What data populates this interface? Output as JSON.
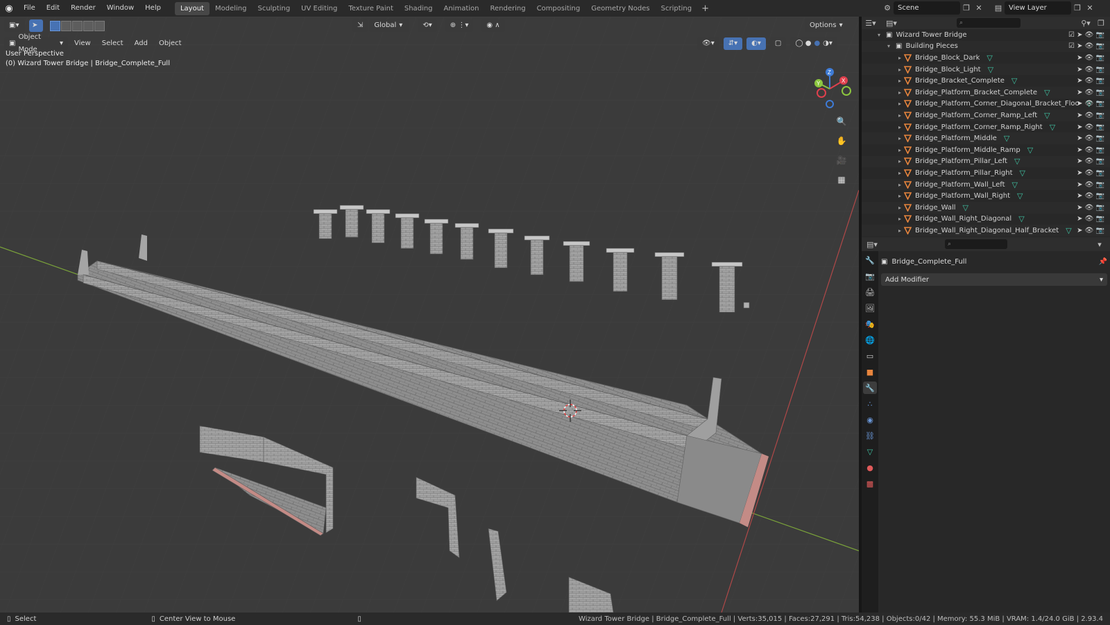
{
  "menu": {
    "file": "File",
    "edit": "Edit",
    "render": "Render",
    "window": "Window",
    "help": "Help"
  },
  "workspaces": [
    "Layout",
    "Modeling",
    "Sculpting",
    "UV Editing",
    "Texture Paint",
    "Shading",
    "Animation",
    "Rendering",
    "Compositing",
    "Geometry Nodes",
    "Scripting"
  ],
  "active_workspace": "Layout",
  "scene": {
    "name": "Scene",
    "view_layer": "View Layer"
  },
  "viewport": {
    "mode": "Object Mode",
    "menus": {
      "view": "View",
      "select": "Select",
      "add": "Add",
      "object": "Object"
    },
    "orientation": "Global",
    "options": "Options",
    "perspective": "User Perspective",
    "object_info": "(0) Wizard Tower Bridge | Bridge_Complete_Full",
    "axes": {
      "x": "X",
      "y": "Y",
      "z": "Z"
    }
  },
  "outliner": {
    "root": "Wizard Tower Bridge",
    "collection": "Building Pieces",
    "items": [
      "Bridge_Block_Dark",
      "Bridge_Block_Light",
      "Bridge_Bracket_Complete",
      "Bridge_Platform_Bracket_Complete",
      "Bridge_Platform_Corner_Diagonal_Bracket_Floo",
      "Bridge_Platform_Corner_Ramp_Left",
      "Bridge_Platform_Corner_Ramp_Right",
      "Bridge_Platform_Middle",
      "Bridge_Platform_Middle_Ramp",
      "Bridge_Platform_Pillar_Left",
      "Bridge_Platform_Pillar_Right",
      "Bridge_Platform_Wall_Left",
      "Bridge_Platform_Wall_Right",
      "Bridge_Wall",
      "Bridge_Wall_Right_Diagonal",
      "Bridge_Wall_Right_Diagonal_Half_Bracket"
    ]
  },
  "properties": {
    "object": "Bridge_Complete_Full",
    "add_modifier": "Add Modifier"
  },
  "status": {
    "left_select": "Select",
    "center_view": "Center View to Mouse",
    "info": "Wizard Tower Bridge | Bridge_Complete_Full | Verts:35,015 | Faces:27,291 | Tris:54,238 | Objects:0/42 | Memory: 55.3 MiB | VRAM: 1.4/24.0 GiB | 2.93.4"
  },
  "colors": {
    "accent": "#4772b3",
    "mesh_orange": "#e8853d",
    "mesh_data_green": "#3fc5a4",
    "axis_x": "#e0404d",
    "axis_y": "#8cc63f",
    "axis_z": "#3e7bd6"
  }
}
